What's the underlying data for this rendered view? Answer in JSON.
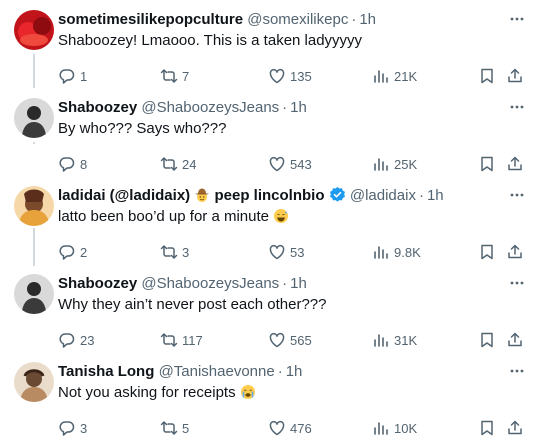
{
  "tweets": [
    {
      "name": "sometimesilikepopculture",
      "handle": "@somexilikepc",
      "dot": "·",
      "time": "1h",
      "text": "Shaboozey! Lmaooo. This is a taken ladyyyyy",
      "replies": "1",
      "retweets": "7",
      "likes": "135",
      "views": "21K"
    },
    {
      "name": "Shaboozey",
      "handle": "@ShaboozeysJeans",
      "dot": "·",
      "time": "1h",
      "text": "By who??? Says who???",
      "replies": "8",
      "retweets": "24",
      "likes": "543",
      "views": "25K"
    },
    {
      "name": "ladidai (@ladidaix)",
      "name_suffix": "peep lincolnbio",
      "handle": "@ladidaix",
      "dot": "·",
      "time": "1h",
      "text": "latto been boo’d up for a minute",
      "replies": "2",
      "retweets": "3",
      "likes": "53",
      "views": "9.8K"
    },
    {
      "name": "Shaboozey",
      "handle": "@ShaboozeysJeans",
      "dot": "·",
      "time": "1h",
      "text": "Why they ain’t never post each other???",
      "replies": "23",
      "retweets": "117",
      "likes": "565",
      "views": "31K"
    },
    {
      "name": "Tanisha Long",
      "handle": "@Tanishaevonne",
      "dot": "·",
      "time": "1h",
      "text": "Not you asking for receipts",
      "replies": "3",
      "retweets": "5",
      "likes": "476",
      "views": "10K"
    }
  ],
  "colors": {
    "text": "#0f1419",
    "secondary": "#536471",
    "verified": "#1d9bf0",
    "divider": "#eff3f4",
    "thread_line": "#cfd9de"
  },
  "icons": [
    "more-icon",
    "reply-icon",
    "retweet-icon",
    "like-icon",
    "views-icon",
    "bookmark-icon",
    "share-icon",
    "cowboy-emoji",
    "verified-badge",
    "sweat-smile-emoji",
    "crying-emoji"
  ]
}
